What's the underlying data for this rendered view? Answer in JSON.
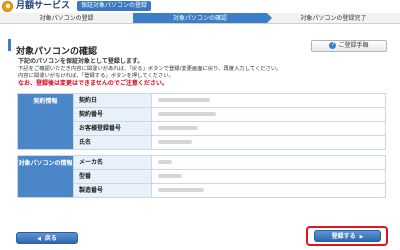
{
  "header": {
    "logo_icon": "monthly-service-logo-icon",
    "app_title": "月額サービス",
    "flow_label": "保証対象パソコンの登録"
  },
  "steps": [
    {
      "label": "対象パソコンの登録",
      "active": false
    },
    {
      "label": "対象パソコンの確認",
      "active": true
    },
    {
      "label": "対象パソコンの登録完了",
      "active": false
    }
  ],
  "page": {
    "title": "対象パソコンの確認",
    "help_button": "ご登録手順"
  },
  "messages": {
    "lead": "下記のパソコンを保証対象として登録します。",
    "line1": "下記をご確認いただき内容に間違いがあれば、「戻る」ボタンで登録/変更画面に戻り、再度入力してください。",
    "line2": "内容に間違いがなければ、「登録する」ボタンを押してください。",
    "warning": "なお、登録後は変更はできませんのでご注意ください。"
  },
  "contract_section": {
    "heading": "契約情報",
    "fields": [
      {
        "label": "契約日"
      },
      {
        "label": "契約番号"
      },
      {
        "label": "お客様登録番号"
      },
      {
        "label": "氏名"
      }
    ]
  },
  "pc_section": {
    "heading": "対象パソコンの情報",
    "fields": [
      {
        "label": "メーカ名"
      },
      {
        "label": "型番"
      },
      {
        "label": "製造番号"
      }
    ]
  },
  "buttons": {
    "back": "戻る",
    "register": "登録する"
  },
  "colors": {
    "accent": "#3d7ec8",
    "logo": "#f39a1b",
    "warning": "#d9001b",
    "highlight_outline": "#e2161c"
  }
}
